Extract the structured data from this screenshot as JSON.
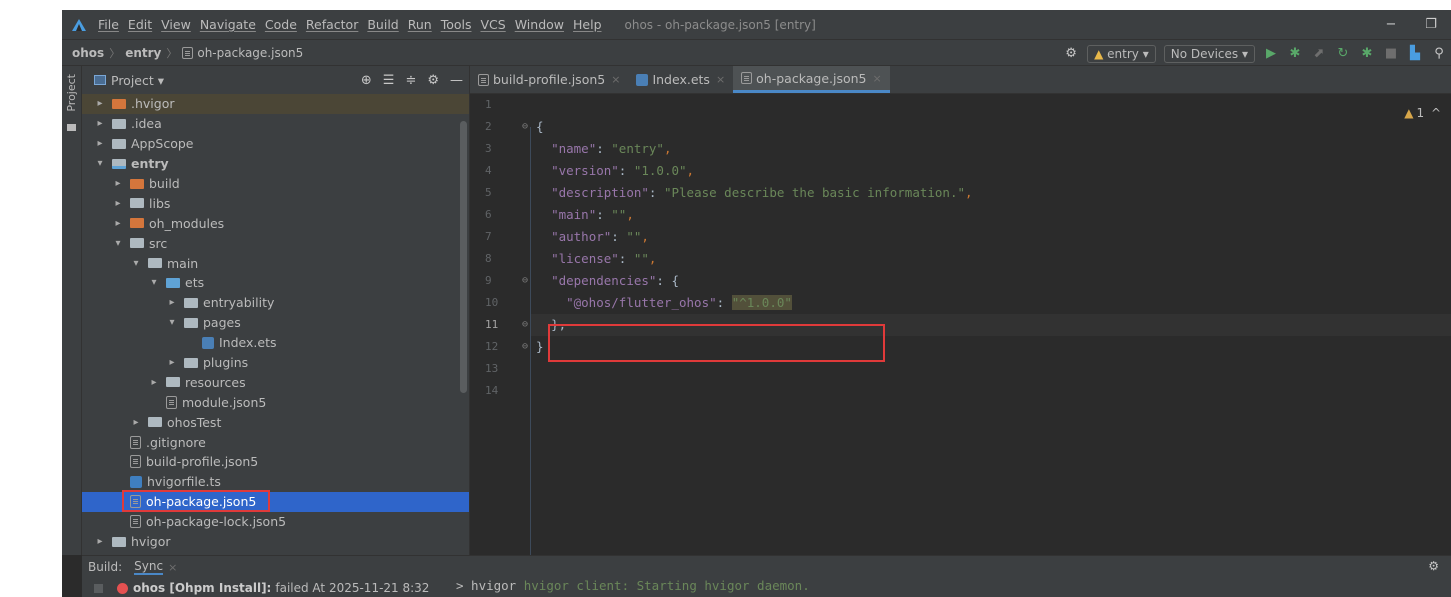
{
  "menu": {
    "items": [
      "File",
      "Edit",
      "View",
      "Navigate",
      "Code",
      "Refactor",
      "Build",
      "Run",
      "Tools",
      "VCS",
      "Window",
      "Help"
    ],
    "window_title": "ohos - oh-package.json5 [entry]"
  },
  "window_controls": {
    "minimize": "−",
    "restore": "❐"
  },
  "breadcrumb": {
    "root": "ohos",
    "module": "entry",
    "file": "oh-package.json5"
  },
  "toolbar": {
    "module_select": "entry ▾",
    "device_select": "No Devices ▾"
  },
  "left_stripe": {
    "label": "Project"
  },
  "project": {
    "header": "Project ▾",
    "tree": [
      {
        "label": ".hvigor",
        "depth": 1,
        "chevron": "right",
        "icon": "folder-orange",
        "excluded": true
      },
      {
        "label": ".idea",
        "depth": 1,
        "chevron": "right",
        "icon": "folder"
      },
      {
        "label": "AppScope",
        "depth": 1,
        "chevron": "right",
        "icon": "folder"
      },
      {
        "label": "entry",
        "depth": 1,
        "chevron": "down",
        "icon": "folder-module",
        "bold": true
      },
      {
        "label": "build",
        "depth": 2,
        "chevron": "right",
        "icon": "folder-orange"
      },
      {
        "label": "libs",
        "depth": 2,
        "chevron": "right",
        "icon": "folder"
      },
      {
        "label": "oh_modules",
        "depth": 2,
        "chevron": "right",
        "icon": "folder-orange"
      },
      {
        "label": "src",
        "depth": 2,
        "chevron": "down",
        "icon": "folder"
      },
      {
        "label": "main",
        "depth": 3,
        "chevron": "down",
        "icon": "folder"
      },
      {
        "label": "ets",
        "depth": 4,
        "chevron": "down",
        "icon": "folder-blue"
      },
      {
        "label": "entryability",
        "depth": 5,
        "chevron": "right",
        "icon": "folder"
      },
      {
        "label": "pages",
        "depth": 5,
        "chevron": "down",
        "icon": "folder"
      },
      {
        "label": "Index.ets",
        "depth": 6,
        "chevron": "none",
        "icon": "ets"
      },
      {
        "label": "plugins",
        "depth": 5,
        "chevron": "right",
        "icon": "folder"
      },
      {
        "label": "resources",
        "depth": 4,
        "chevron": "right",
        "icon": "folder"
      },
      {
        "label": "module.json5",
        "depth": 4,
        "chevron": "none",
        "icon": "json"
      },
      {
        "label": "ohosTest",
        "depth": 3,
        "chevron": "right",
        "icon": "folder"
      },
      {
        "label": ".gitignore",
        "depth": 2,
        "chevron": "none",
        "icon": "json"
      },
      {
        "label": "build-profile.json5",
        "depth": 2,
        "chevron": "none",
        "icon": "json"
      },
      {
        "label": "hvigorfile.ts",
        "depth": 2,
        "chevron": "none",
        "icon": "ts"
      },
      {
        "label": "oh-package.json5",
        "depth": 2,
        "chevron": "none",
        "icon": "json",
        "selected": true
      },
      {
        "label": "oh-package-lock.json5",
        "depth": 2,
        "chevron": "none",
        "icon": "json"
      },
      {
        "label": "hvigor",
        "depth": 1,
        "chevron": "right",
        "icon": "folder"
      }
    ]
  },
  "editor": {
    "tabs": [
      {
        "label": "build-profile.json5",
        "icon": "json",
        "active": false
      },
      {
        "label": "Index.ets",
        "icon": "ets",
        "active": false
      },
      {
        "label": "oh-package.json5",
        "icon": "json",
        "active": true
      }
    ],
    "warning_count": "1",
    "line_numbers": [
      "1",
      "2",
      "3",
      "4",
      "5",
      "6",
      "7",
      "8",
      "9",
      "10",
      "11",
      "12",
      "13",
      "14"
    ],
    "current_line": 11,
    "code": {
      "l2": "{",
      "name_key": "\"name\"",
      "name_val": "\"entry\"",
      "version_key": "\"version\"",
      "version_val": "\"1.0.0\"",
      "desc_key": "\"description\"",
      "desc_val": "\"Please describe the basic information.\"",
      "main_key": "\"main\"",
      "main_val": "\"\"",
      "author_key": "\"author\"",
      "author_val": "\"\"",
      "license_key": "\"license\"",
      "license_val": "\"\"",
      "deps_key": "\"dependencies\"",
      "dep_key": "\"@ohos/flutter_ohos\"",
      "dep_val": "\"^1.0.0\"",
      "l11": "},",
      "l12": "}"
    }
  },
  "build": {
    "label": "Build:",
    "tab": "Sync",
    "task": "ohos [Ohpm Install]:",
    "task_status": "failed At 2025-11-21 8:32",
    "console_prefix": "> hvigor",
    "console_text": "hvigor client: Starting hvigor daemon."
  },
  "colors": {
    "highlight_box": "#e03a3a",
    "selection": "#2f65ca",
    "string": "#6a8759",
    "key": "#9876aa"
  }
}
